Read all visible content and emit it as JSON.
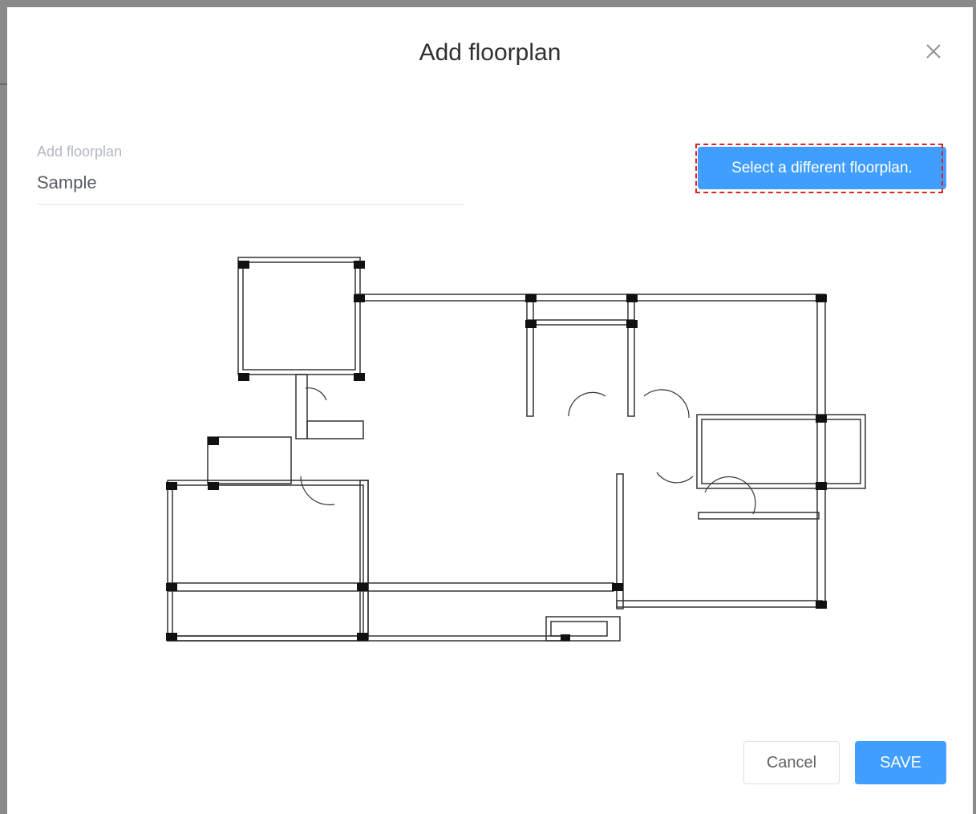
{
  "dialog": {
    "title": "Add floorplan"
  },
  "form": {
    "label": "Add floorplan",
    "value": "Sample"
  },
  "buttons": {
    "select_different": "Select a different floorplan.",
    "cancel": "Cancel",
    "save": "SAVE"
  },
  "icons": {
    "close": "close-icon"
  },
  "colors": {
    "primary": "#409eff",
    "focus_ring": "#e02424",
    "title_text": "#303133",
    "label_text": "#b4b8c5"
  }
}
